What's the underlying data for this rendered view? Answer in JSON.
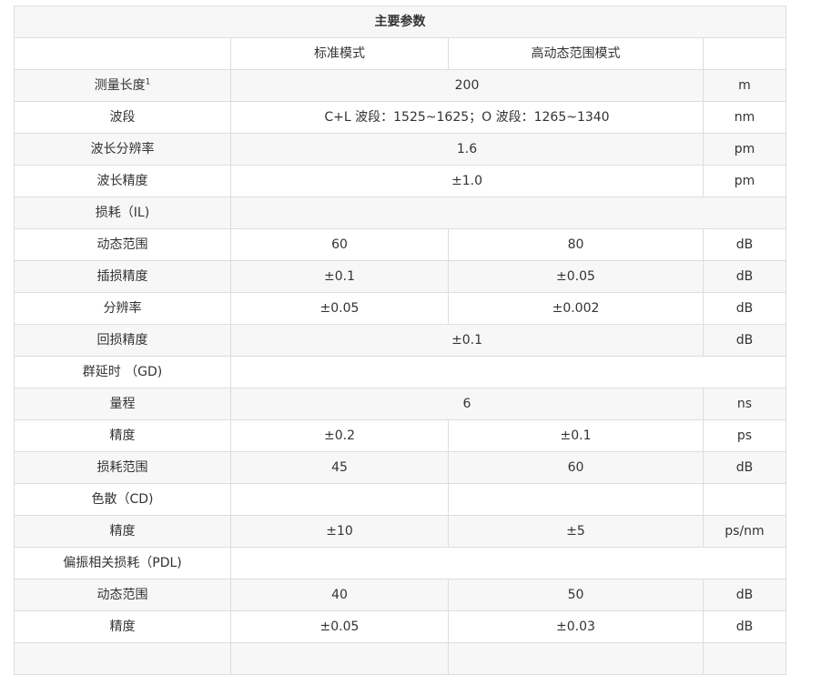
{
  "table_title": "主要参数",
  "mode_headers": {
    "standard": "标准模式",
    "hdr": "高动态范围模式"
  },
  "rows": {
    "measure_length": {
      "label": "测量长度",
      "sup": "1",
      "value": "200",
      "unit": "m"
    },
    "band": {
      "label": "波段",
      "value": "C+L 波段：1525~1625；O 波段：1265~1340",
      "unit": "nm"
    },
    "wl_resolution": {
      "label": "波长分辨率",
      "value": "1.6",
      "unit": "pm"
    },
    "wl_accuracy": {
      "label": "波长精度",
      "value": "±1.0",
      "unit": "pm"
    },
    "il_section": {
      "label": "损耗（IL)"
    },
    "il_dynamic_range": {
      "label": "动态范围",
      "standard": "60",
      "hdr": "80",
      "unit": "dB"
    },
    "il_accuracy": {
      "label": "插损精度",
      "standard": "±0.1",
      "hdr": "±0.05",
      "unit": "dB"
    },
    "il_resolution": {
      "label": "分辨率",
      "standard": "±0.05",
      "hdr": "±0.002",
      "unit": "dB"
    },
    "rl_accuracy": {
      "label": "回损精度",
      "value": "±0.1",
      "unit": "dB"
    },
    "gd_section": {
      "label": "群延时 （GD)"
    },
    "gd_range": {
      "label": "量程",
      "value": "6",
      "unit": "ns"
    },
    "gd_accuracy": {
      "label": "精度",
      "standard": "±0.2",
      "hdr": "±0.1",
      "unit": "ps"
    },
    "gd_loss_range": {
      "label": "损耗范围",
      "standard": "45",
      "hdr": "60",
      "unit": "dB"
    },
    "cd_section": {
      "label": "色散（CD)"
    },
    "cd_accuracy": {
      "label": "精度",
      "standard": "±10",
      "hdr": "±5",
      "unit": "ps/nm"
    },
    "pdl_section": {
      "label": "偏振相关损耗（PDL)"
    },
    "pdl_dynamic_range": {
      "label": "动态范围",
      "standard": "40",
      "hdr": "50",
      "unit": "dB"
    },
    "pdl_accuracy": {
      "label": "精度",
      "standard": "±0.05",
      "hdr": "±0.03",
      "unit": "dB"
    }
  }
}
